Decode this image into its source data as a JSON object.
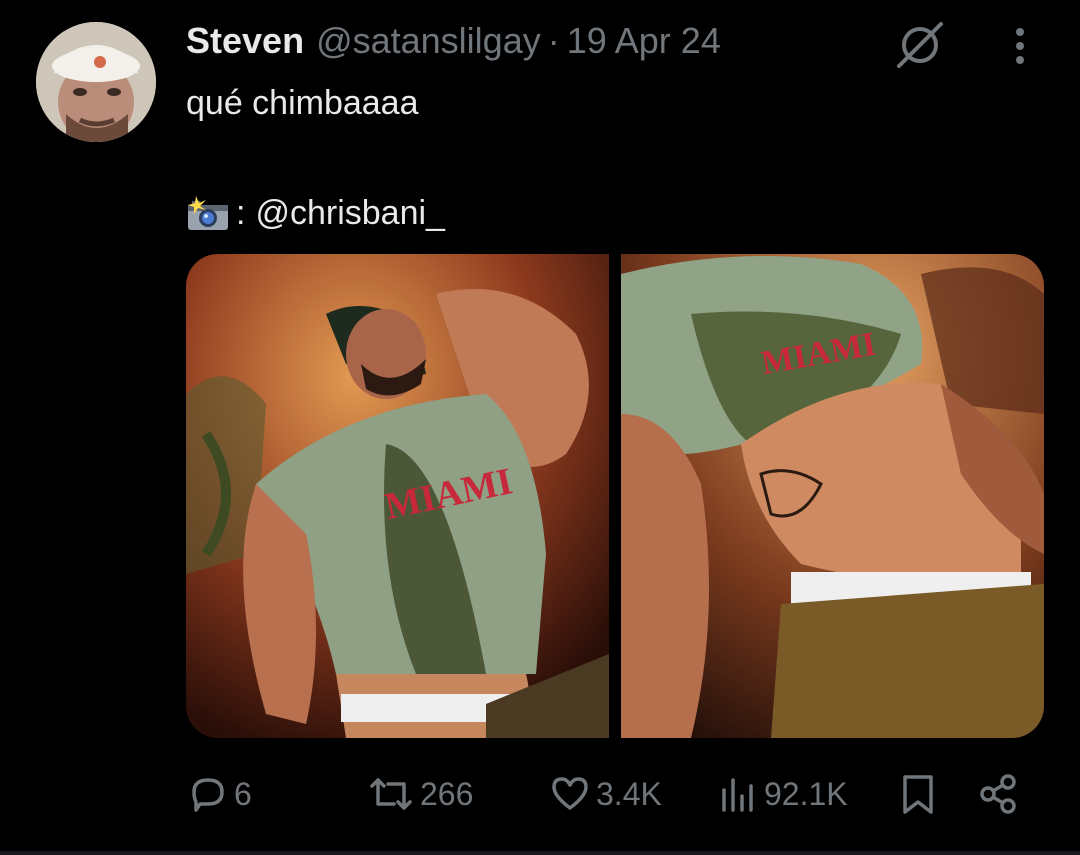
{
  "author": {
    "name": "Steven",
    "handle": "@satanslilgay",
    "separator": "·",
    "date": "19 Apr 24"
  },
  "tweet": {
    "text_line1": "qué chimbaaaa",
    "credit_prefix": ":",
    "credit_mention": "@chrisbani_",
    "credit_icon": "camera-flash-icon"
  },
  "media": {
    "photo1_print": "MIAMI",
    "photo2_print": "MIAMI"
  },
  "actions": {
    "replies": "6",
    "reposts": "266",
    "likes": "3.4K",
    "views": "92.1K"
  },
  "colors": {
    "background": "#000000",
    "text_primary": "#e7e9ea",
    "text_secondary": "#71767b"
  }
}
